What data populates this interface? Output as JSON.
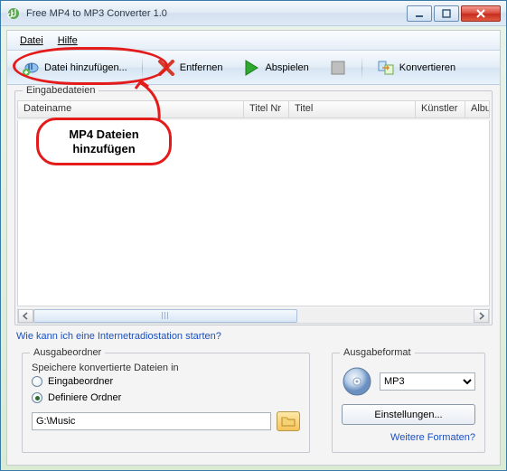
{
  "title": "Free MP4 to MP3 Converter 1.0",
  "menu": {
    "file": "Datei",
    "help": "Hilfe"
  },
  "toolbar": {
    "add": "Datei hinzufügen...",
    "remove": "Entfernen",
    "play": "Abspielen",
    "convert": "Konvertieren"
  },
  "files": {
    "legend": "Eingabedateien",
    "cols": {
      "name": "Dateiname",
      "trackno": "Titel Nr",
      "title": "Titel",
      "artist": "Künstler",
      "album": "Albu"
    }
  },
  "link_radio": "Wie kann ich eine Internetradiostation starten?",
  "out_folder": {
    "legend": "Ausgabeordner",
    "save_label": "Speichere konvertierte Dateien in",
    "opt_input": "Eingabeordner",
    "opt_define": "Definiere Ordner",
    "path": "G:\\Music"
  },
  "out_format": {
    "legend": "Ausgabeformat",
    "value": "MP3",
    "settings": "Einstellungen...",
    "more": "Weitere Formaten?"
  },
  "annotation": {
    "text": "MP4 Dateien\nhinzufügen"
  }
}
